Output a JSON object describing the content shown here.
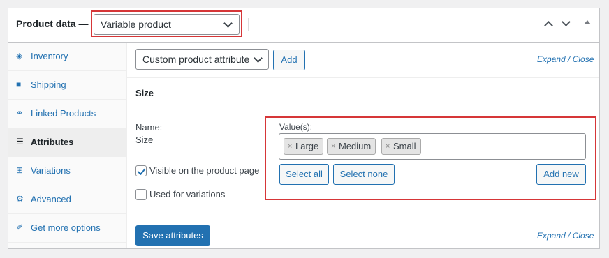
{
  "header": {
    "title": "Product data —",
    "product_type": "Variable product"
  },
  "sidebar": {
    "items": [
      {
        "label": "Inventory",
        "icon": "tag-icon",
        "glyph": "◈"
      },
      {
        "label": "Shipping",
        "icon": "truck-icon",
        "glyph": "■"
      },
      {
        "label": "Linked Products",
        "icon": "link-icon",
        "glyph": "⚭"
      },
      {
        "label": "Attributes",
        "icon": "list-icon",
        "glyph": "☰",
        "active": true
      },
      {
        "label": "Variations",
        "icon": "grid-icon",
        "glyph": "⊞"
      },
      {
        "label": "Advanced",
        "icon": "gear-icon",
        "glyph": "⚙"
      },
      {
        "label": "Get more options",
        "icon": "plugin-icon",
        "glyph": "✐"
      }
    ]
  },
  "toolbar": {
    "attribute_select": "Custom product attribute",
    "add_label": "Add",
    "expand": "Expand",
    "separator": " / ",
    "close": "Close"
  },
  "attribute": {
    "title": "Size",
    "name_label": "Name:",
    "name_value": "Size",
    "visible_label": "Visible on the product page",
    "visible_checked": true,
    "variations_label": "Used for variations",
    "variations_checked": false,
    "values_label": "Value(s):",
    "values": [
      "Large",
      "Medium",
      "Small"
    ],
    "remove_glyph": "×",
    "select_all": "Select all",
    "select_none": "Select none",
    "add_new": "Add new"
  },
  "footer": {
    "save_label": "Save attributes",
    "expand": "Expand",
    "separator": " / ",
    "close": "Close"
  },
  "colors": {
    "accent": "#2271b1",
    "highlight": "#d63638"
  }
}
